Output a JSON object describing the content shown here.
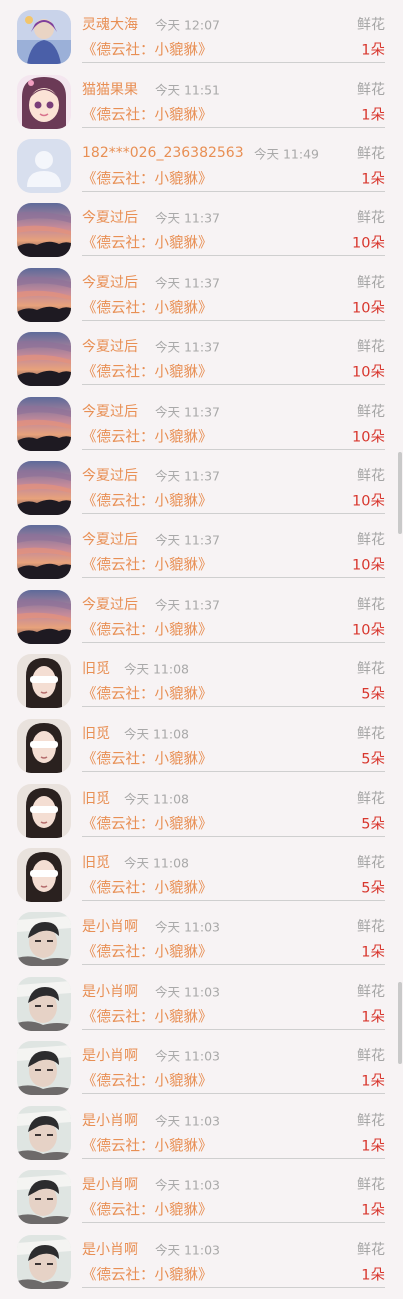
{
  "work_title": "《德云社：小貔貅》",
  "gift_label": "鲜花",
  "rows": [
    {
      "avatar": "avatar-art-icon",
      "name": "灵魂大海",
      "time": "今天 12:07",
      "count": "1朵"
    },
    {
      "avatar": "avatar-cartoon-girl-icon",
      "name": "猫猫果果",
      "time": "今天 11:51",
      "count": "1朵"
    },
    {
      "avatar": "avatar-default-icon",
      "name": "182***026_236382563",
      "time": "今天 11:49",
      "count": "1朵"
    },
    {
      "avatar": "avatar-sunset-icon",
      "name": "今夏过后",
      "time": "今天 11:37",
      "count": "10朵"
    },
    {
      "avatar": "avatar-sunset-icon",
      "name": "今夏过后",
      "time": "今天 11:37",
      "count": "10朵"
    },
    {
      "avatar": "avatar-sunset-icon",
      "name": "今夏过后",
      "time": "今天 11:37",
      "count": "10朵"
    },
    {
      "avatar": "avatar-sunset-icon",
      "name": "今夏过后",
      "time": "今天 11:37",
      "count": "10朵"
    },
    {
      "avatar": "avatar-sunset-icon",
      "name": "今夏过后",
      "time": "今天 11:37",
      "count": "10朵"
    },
    {
      "avatar": "avatar-sunset-icon",
      "name": "今夏过后",
      "time": "今天 11:37",
      "count": "10朵"
    },
    {
      "avatar": "avatar-sunset-icon",
      "name": "今夏过后",
      "time": "今天 11:37",
      "count": "10朵"
    },
    {
      "avatar": "avatar-girl-photo-icon",
      "name": "旧觅",
      "time": "今天 11:08",
      "count": "5朵"
    },
    {
      "avatar": "avatar-girl-photo-icon",
      "name": "旧觅",
      "time": "今天 11:08",
      "count": "5朵"
    },
    {
      "avatar": "avatar-girl-photo-icon",
      "name": "旧觅",
      "time": "今天 11:08",
      "count": "5朵"
    },
    {
      "avatar": "avatar-girl-photo-icon",
      "name": "旧觅",
      "time": "今天 11:08",
      "count": "5朵"
    },
    {
      "avatar": "avatar-boy-photo-icon",
      "name": "是小肖啊",
      "time": "今天 11:03",
      "count": "1朵"
    },
    {
      "avatar": "avatar-boy-photo-icon",
      "name": "是小肖啊",
      "time": "今天 11:03",
      "count": "1朵"
    },
    {
      "avatar": "avatar-boy-photo-icon",
      "name": "是小肖啊",
      "time": "今天 11:03",
      "count": "1朵"
    },
    {
      "avatar": "avatar-boy-photo-icon",
      "name": "是小肖啊",
      "time": "今天 11:03",
      "count": "1朵"
    },
    {
      "avatar": "avatar-boy-photo-icon",
      "name": "是小肖啊",
      "time": "今天 11:03",
      "count": "1朵"
    },
    {
      "avatar": "avatar-boy-photo-icon",
      "name": "是小肖啊",
      "time": "今天 11:03",
      "count": "1朵"
    }
  ],
  "colors": {
    "name": "#e88f54",
    "count": "#d8372e",
    "secondary": "#a9a9a9",
    "background": "#f7f3f4"
  }
}
